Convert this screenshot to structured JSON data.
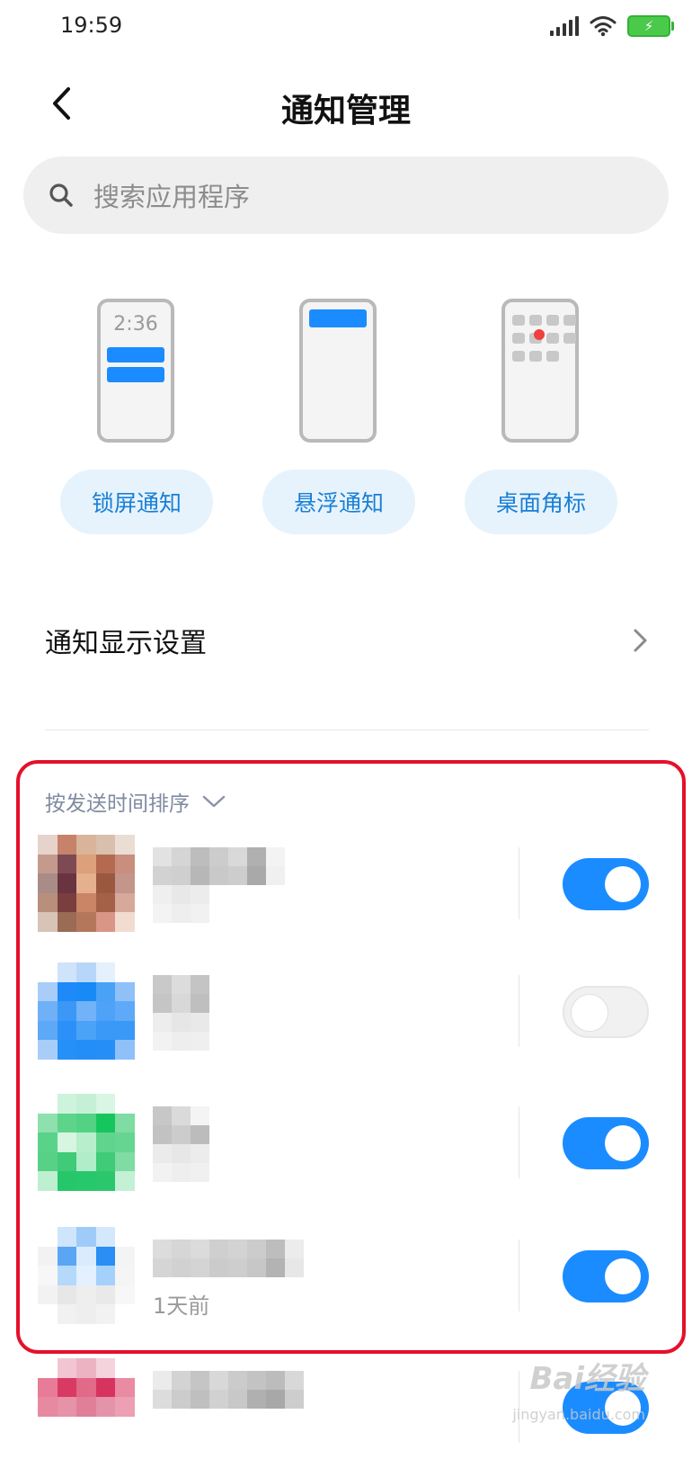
{
  "status_bar": {
    "time": "19:59",
    "battery": "⚡"
  },
  "header": {
    "title": "通知管理"
  },
  "search": {
    "placeholder": "搜索应用程序"
  },
  "features": [
    {
      "label": "锁屏通知",
      "preview_time": "2:36",
      "illustration": "lock-screen-preview"
    },
    {
      "label": "悬浮通知",
      "illustration": "floating-preview"
    },
    {
      "label": "桌面角标",
      "illustration": "badge-preview"
    }
  ],
  "settings": {
    "display_label": "通知显示设置"
  },
  "sort": {
    "label": "按发送时间排序"
  },
  "apps": [
    {
      "enabled": true
    },
    {
      "enabled": false
    },
    {
      "enabled": true
    },
    {
      "enabled": true,
      "time_ago": "1天前"
    },
    {
      "enabled": true
    }
  ],
  "watermark": {
    "brand": "Bai经验",
    "url": "jingyan.baidu.com"
  },
  "colors": {
    "accent": "#1a8cff",
    "highlight_border": "#e5102b",
    "pill_bg": "#e6f3fc"
  }
}
